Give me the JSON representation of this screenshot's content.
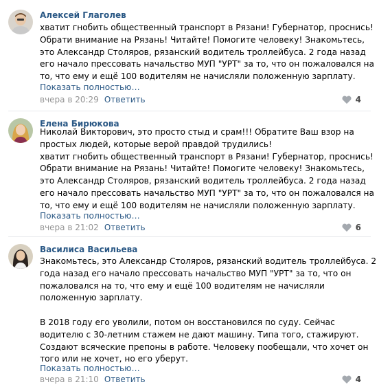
{
  "comments": [
    {
      "author": "Алексей Глаголев",
      "lines": [
        "хватит гнобить общественный транспорт в Рязани! Губернатор, проснись!",
        "Обрати внимание на Рязань! Читайте! Помогите человеку! Знакомьтесь,",
        "это Александр Столяров, рязанский водитель троллейбуса. 2 года назад",
        "его начало прессовать начальство МУП \"УРТ\" за то, что он пожаловался на",
        "то, что ему и ещё 100 водителям не начисляли положенную зарплату."
      ],
      "more": "Показать полностью…",
      "date": "вчера в 20:29",
      "reply": "Ответить",
      "likes": "4",
      "avatar_icon": "user-photo-male"
    },
    {
      "author": "Елена Бирюкова",
      "lines": [
        "Николай Викторович, это просто стыд и срам!!! Обратите Ваш взор на",
        "простых людей, которые верой правдой трудились!",
        "хватит гнобить общественный транспорт в Рязани! Губернатор, проснись!",
        "Обрати внимание на Рязань! Читайте! Помогите человеку! Знакомьтесь,",
        "это Александр Столяров, рязанский водитель троллейбуса. 2 года назад",
        "его начало прессовать начальство МУП \"УРТ\" за то, что он пожаловался на",
        "то, что ему и ещё 100 водителям не начисляли положенную зарплату."
      ],
      "more": "Показать полностью…",
      "date": "вчера в 21:02",
      "reply": "Ответить",
      "likes": "6",
      "avatar_icon": "user-photo-female-blonde"
    },
    {
      "author": "Василиса Васильева",
      "lines": [
        "Знакомьтесь, это Александр Столяров, рязанский водитель троллейбуса. 2",
        "года назад его начало прессовать начальство МУП \"УРТ\" за то, что он",
        "пожаловался на то, что ему и ещё 100 водителям не начисляли",
        "положенную зарплату.",
        "",
        "В 2018 году его уволили, потом он восстановился по суду. Сейчас",
        "водителю с 30-летним стажем не дают машину. Типа того, стажируют.",
        "Создают всяческие препоны в работе. Человеку пообещали, что хочет он",
        "того или не хочет, но его уберут."
      ],
      "more": "Показать полностью…",
      "date": "вчера в 21:10",
      "reply": "Ответить",
      "likes": "4",
      "avatar_icon": "user-photo-female-dark"
    }
  ],
  "colors": {
    "link": "#2a5885",
    "meta_gray": "#939393",
    "separator": "#e7e8ec",
    "heart": "#a4a9af"
  }
}
